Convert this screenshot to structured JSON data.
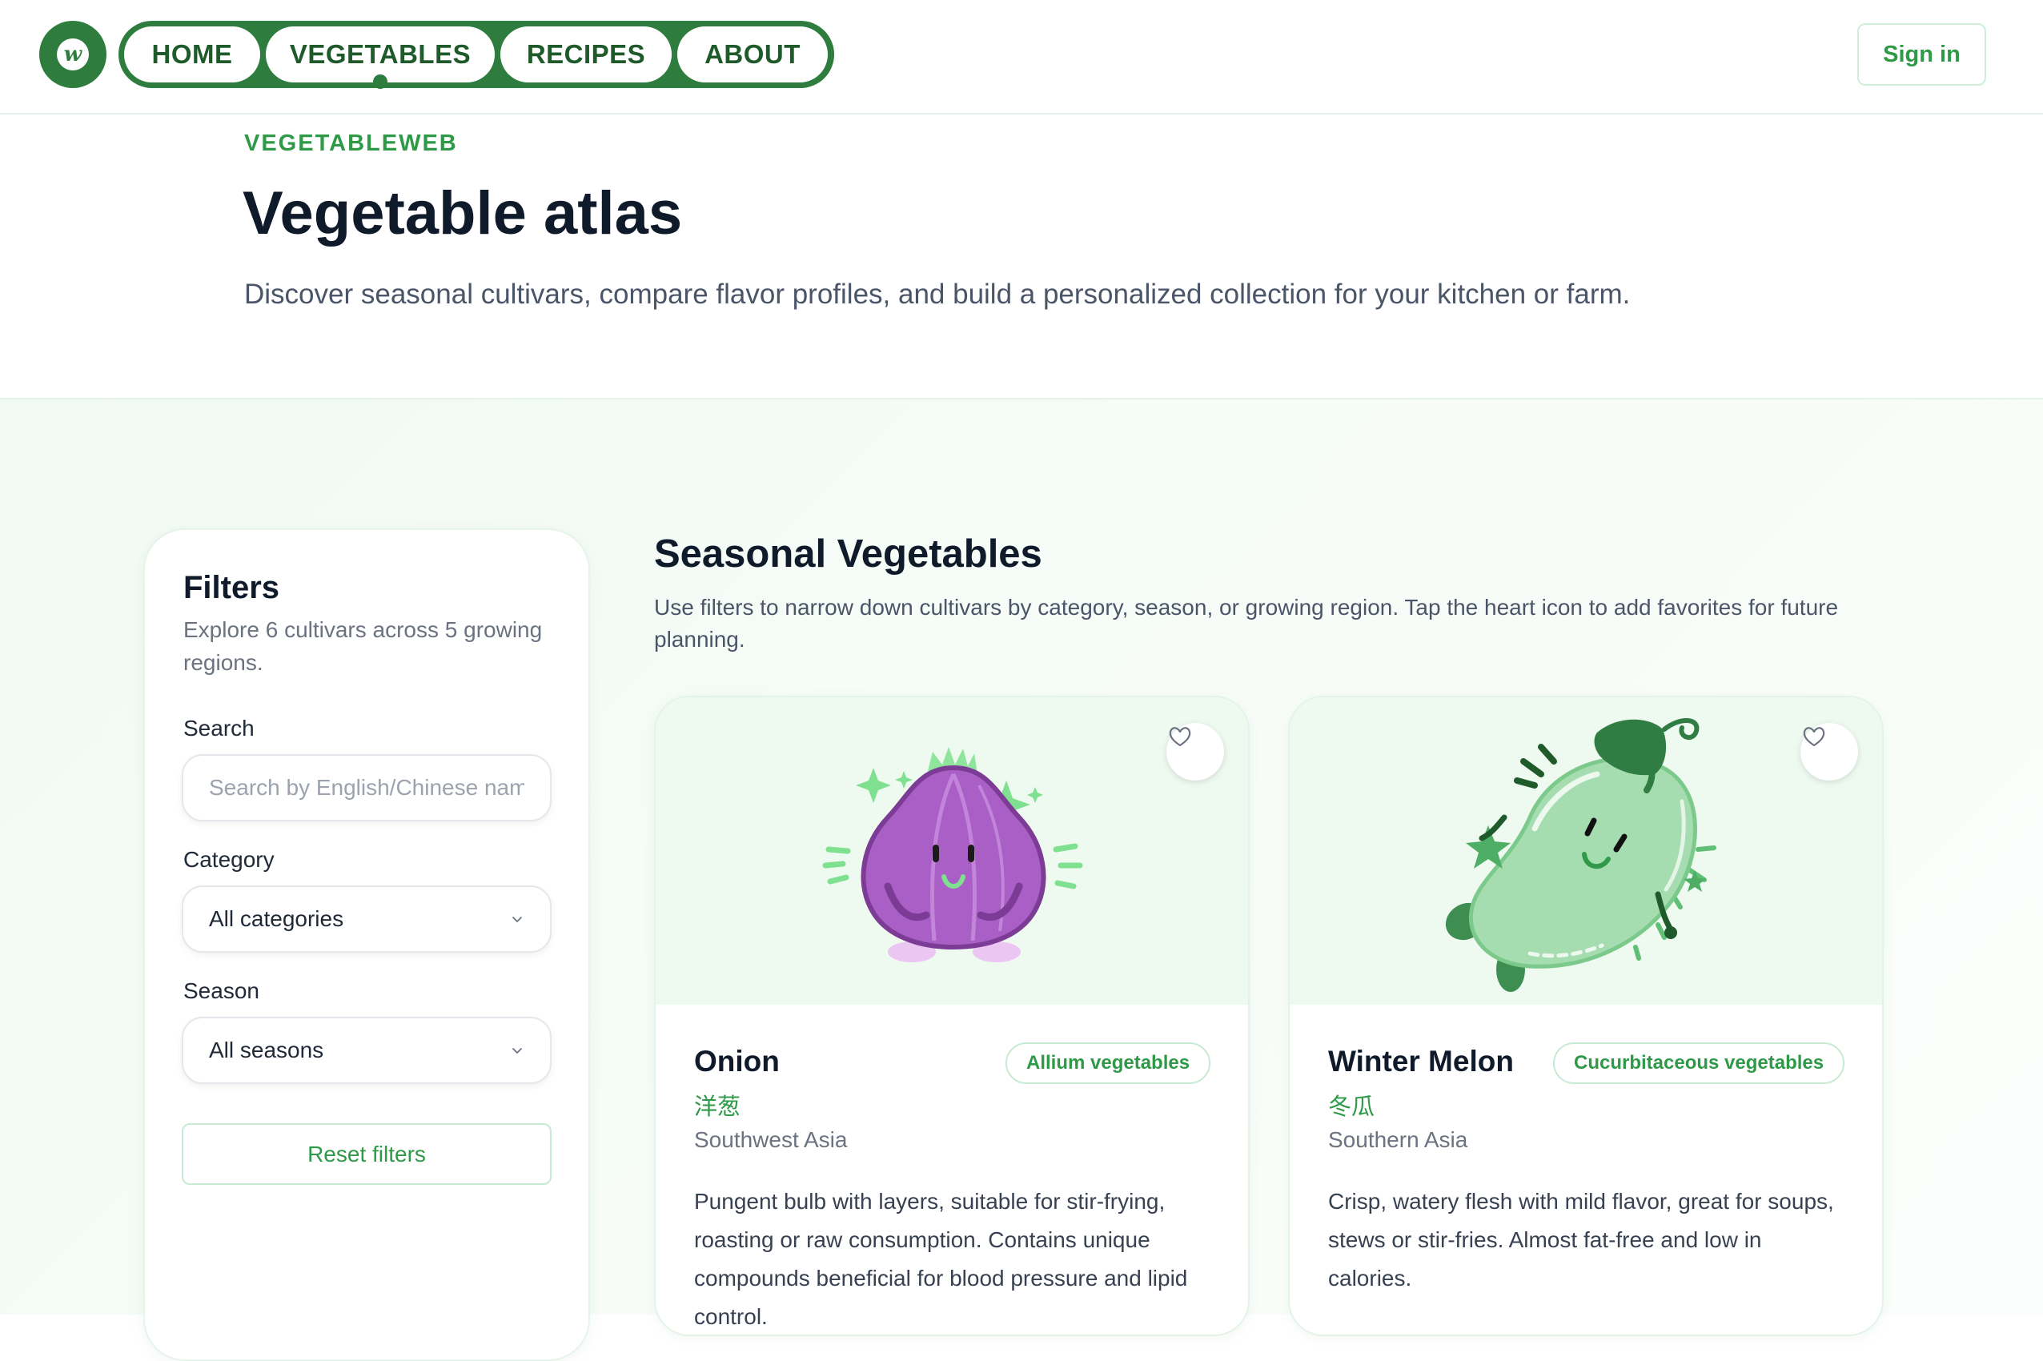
{
  "nav": {
    "items": [
      {
        "label": "HOME"
      },
      {
        "label": "VEGETABLES",
        "active": true
      },
      {
        "label": "RECIPES"
      },
      {
        "label": "ABOUT"
      }
    ],
    "sign_in": "Sign in"
  },
  "hero": {
    "kicker": "VEGETABLEWEB",
    "title": "Vegetable atlas",
    "subtitle": "Discover seasonal cultivars, compare flavor profiles, and build a personalized collection for your kitchen or farm."
  },
  "filters": {
    "title": "Filters",
    "description": "Explore 6 cultivars across 5 growing regions.",
    "search_label": "Search",
    "search_placeholder": "Search by English/Chinese name",
    "category_label": "Category",
    "category_value": "All categories",
    "season_label": "Season",
    "season_value": "All seasons",
    "reset_label": "Reset filters"
  },
  "section": {
    "title": "Seasonal Vegetables",
    "description": "Use filters to narrow down cultivars by category, season, or growing region. Tap the heart icon to add favorites for future planning."
  },
  "cards": [
    {
      "name": "Onion",
      "chinese": "洋葱",
      "origin": "Southwest Asia",
      "category": "Allium vegetables",
      "description": "Pungent bulb with layers, suitable for stir-frying, roasting or raw consumption. Contains unique compounds beneficial for blood pressure and lipid control.",
      "icon": "onion-illustration"
    },
    {
      "name": "Winter Melon",
      "chinese": "冬瓜",
      "origin": "Southern Asia",
      "category": "Cucurbitaceous vegetables",
      "description": "Crisp, watery flesh with mild flavor, great for soups, stews or stir-fries. Almost fat-free and low in calories.",
      "icon": "winter-melon-illustration"
    }
  ],
  "colors": {
    "brand": "#2e7d3e",
    "accent": "#2e9a47",
    "onion": "#a95fc6",
    "melon": "#a6ddb0"
  }
}
